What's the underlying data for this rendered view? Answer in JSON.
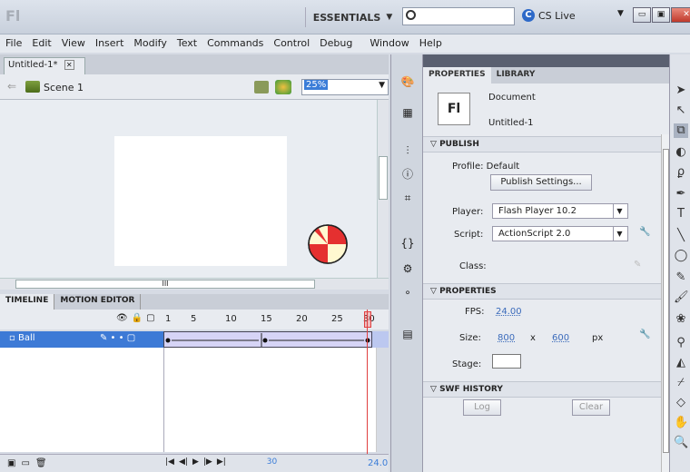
{
  "app": {
    "logo": "Fl"
  },
  "workspace": {
    "label": "ESSENTIALS",
    "arrow": "▼"
  },
  "search": {
    "placeholder": ""
  },
  "cslive": {
    "label": "CS Live",
    "arrow": "▼"
  },
  "window_buttons": {
    "minimize": "▭",
    "restore": "▣",
    "close": "✕"
  },
  "menu": [
    "File",
    "Edit",
    "View",
    "Insert",
    "Modify",
    "Text",
    "Commands",
    "Control",
    "Debug",
    "Window",
    "Help"
  ],
  "document": {
    "tab": "Untitled-1*",
    "close": "✕"
  },
  "scene": {
    "back": "⇐",
    "label": "Scene 1"
  },
  "zoom": {
    "value": "25%"
  },
  "scrollbar": {
    "grip": "III"
  },
  "timeline": {
    "tabs": [
      "TIMELINE",
      "MOTION EDITOR"
    ],
    "ruler": [
      "1",
      "5",
      "10",
      "15",
      "20",
      "25",
      "30"
    ],
    "layer": {
      "name": "Ball"
    },
    "header_icons": [
      "👁",
      "🔒",
      "▢"
    ],
    "controls": [
      "|◀",
      "◀|",
      "▶",
      "|▶",
      "▶|"
    ],
    "frame": "30",
    "fps": "24.0"
  },
  "properties": {
    "tabs": [
      "PROPERTIES",
      "LIBRARY"
    ],
    "doc_icon": "Fl",
    "doc_type": "Document",
    "doc_name": "Untitled-1",
    "publish": {
      "header": "PUBLISH",
      "profile_label": "Profile: Default",
      "publish_settings": "Publish Settings...",
      "player_label": "Player:",
      "player_value": "Flash Player 10.2",
      "script_label": "Script:",
      "script_value": "ActionScript 2.0",
      "class_label": "Class:"
    },
    "props": {
      "header": "PROPERTIES",
      "fps_label": "FPS:",
      "fps_value": "24.00",
      "size_label": "Size:",
      "width": "800",
      "x": "x",
      "height": "600",
      "unit": "px",
      "stage_label": "Stage:"
    },
    "swf": {
      "header": "SWF HISTORY",
      "log": "Log",
      "clear": "Clear"
    }
  },
  "colors": {
    "accent": "#3d7ad6",
    "playhead": "#e04040",
    "ball_red": "#e53030",
    "ball_cream": "#fff8d0"
  }
}
